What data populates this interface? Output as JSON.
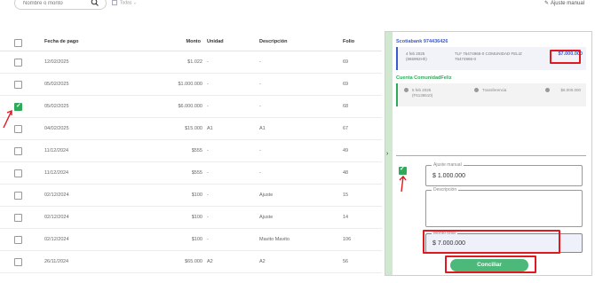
{
  "toolbar": {
    "search_placeholder": "Nombre o monto",
    "date_filter": "Todas",
    "ajuste_manual": "Ajuste manual"
  },
  "table": {
    "headers": {
      "fecha": "Fecha de pago",
      "monto": "Monto",
      "unidad": "Unidad",
      "descripcion": "Descripción",
      "folio": "Folio"
    },
    "rows": [
      {
        "fecha": "12/02/2025",
        "monto": "$1.022",
        "unidad": "-",
        "desc": "-",
        "folio": "69",
        "checked": false
      },
      {
        "fecha": "05/02/2025",
        "monto": "$1.000.000",
        "unidad": "-",
        "desc": "-",
        "folio": "69",
        "checked": false
      },
      {
        "fecha": "05/02/2025",
        "monto": "$6.000.000",
        "unidad": "-",
        "desc": "-",
        "folio": "68",
        "checked": true
      },
      {
        "fecha": "04/02/2025",
        "monto": "$15.000",
        "unidad": "A1",
        "desc": "A1",
        "folio": "67",
        "checked": false
      },
      {
        "fecha": "11/12/2024",
        "monto": "$555",
        "unidad": "-",
        "desc": "-",
        "folio": "49",
        "checked": false
      },
      {
        "fecha": "11/12/2024",
        "monto": "$555",
        "unidad": "-",
        "desc": "-",
        "folio": "48",
        "checked": false
      },
      {
        "fecha": "02/12/2024",
        "monto": "$100",
        "unidad": "-",
        "desc": "Ajuste",
        "folio": "15",
        "checked": false
      },
      {
        "fecha": "02/12/2024",
        "monto": "$100",
        "unidad": "-",
        "desc": "Ajuste",
        "folio": "14",
        "checked": false
      },
      {
        "fecha": "02/12/2024",
        "monto": "$100",
        "unidad": "-",
        "desc": "Mavito Mavito",
        "folio": "106",
        "checked": false
      },
      {
        "fecha": "26/11/2024",
        "monto": "$65.000",
        "unidad": "A2",
        "desc": "A2",
        "folio": "56",
        "checked": false
      }
    ]
  },
  "panel": {
    "bank_title": "Scotiabank 974436426",
    "bank_date": "4 feb 2025 (965992Hh)",
    "bank_desc": "TLF 76474965-0 COMUNIDAD FELIZ 76474965-0",
    "bank_amount": "$7.000.000",
    "account_title": "Cuenta ComunidadFeliz",
    "account_date": "5 feb 2025 (F5138510)",
    "account_type": "Transferencia",
    "account_amount": "$6.000.000",
    "ajuste_label": "Ajuste manual",
    "ajuste_value": "$ 1.000.000",
    "descripcion_label": "Descripción",
    "total_label": "Monto total",
    "total_value": "$ 7.000.000",
    "conciliar": "Conciliar"
  },
  "colors": {
    "accent_blue": "#3a5bd0",
    "accent_green": "#2eaa5a",
    "button_green": "#4cb87a",
    "annotation_red": "#e0191f"
  }
}
